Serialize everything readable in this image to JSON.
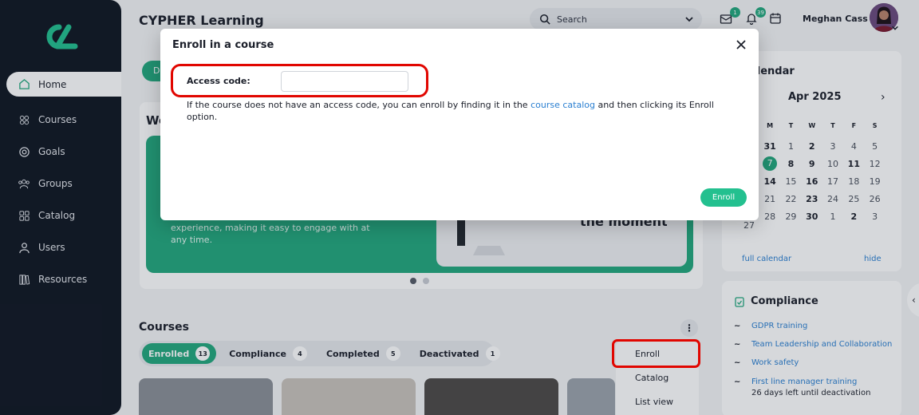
{
  "app": {
    "title": "CYPHER Learning"
  },
  "colors": {
    "accent": "#23a87d",
    "highlight": "#e10600",
    "link": "#2a7fd1",
    "sidebar": "#0f1622"
  },
  "sidebar": {
    "items": [
      {
        "label": "Home",
        "icon": "home-icon"
      },
      {
        "label": "Courses",
        "icon": "courses-icon"
      },
      {
        "label": "Goals",
        "icon": "goals-icon"
      },
      {
        "label": "Groups",
        "icon": "groups-icon"
      },
      {
        "label": "Catalog",
        "icon": "catalog-icon"
      },
      {
        "label": "Users",
        "icon": "users-icon"
      },
      {
        "label": "Resources",
        "icon": "resources-icon"
      }
    ]
  },
  "header": {
    "search_placeholder": "Search",
    "messages_badge": "1",
    "notifications_badge": "39",
    "user_name": "Meghan Cass"
  },
  "main": {
    "welcome_partial": "We",
    "pill_partial": "D",
    "panel_text": "experience, making it easy to engage with at any time.",
    "panel_heading_partial": "the moment",
    "courses_title": "Courses",
    "kebab": "⋮",
    "tabs": [
      {
        "label": "Enrolled",
        "count": "13"
      },
      {
        "label": "Compliance",
        "count": "4"
      },
      {
        "label": "Completed",
        "count": "5"
      },
      {
        "label": "Deactivated",
        "count": "1"
      }
    ],
    "menu": [
      "Enroll",
      "Catalog",
      "List view"
    ]
  },
  "calendar": {
    "title": "Calendar",
    "title_visible": "alendar",
    "month": "Apr 2025",
    "weekdays": [
      "M",
      "T",
      "W",
      "T",
      "F",
      "S"
    ],
    "weeks": [
      [
        "31",
        "1",
        "2",
        "3",
        "4",
        "5"
      ],
      [
        "7",
        "8",
        "9",
        "10",
        "11",
        "12"
      ],
      [
        "14",
        "15",
        "16",
        "17",
        "18",
        "19"
      ],
      [
        "21",
        "22",
        "23",
        "24",
        "25",
        "26"
      ],
      [
        "28",
        "29",
        "30",
        "1",
        "2",
        "3"
      ]
    ],
    "partial_col": [
      "27"
    ],
    "full_calendar": "full calendar",
    "hide": "hide"
  },
  "compliance": {
    "title": "Compliance",
    "items": [
      "GDPR training",
      "Team Leadership and Collaboration",
      "Work safety",
      "First line manager training"
    ],
    "last_item_sub": "26 days left until deactivation"
  },
  "modal": {
    "title": "Enroll in a course",
    "access_label": "Access code:",
    "access_value": "",
    "help_before": "If the course does not have an access code, you can enroll by finding it in the ",
    "help_link": "course catalog",
    "help_after": " and then clicking its Enroll option.",
    "enroll_label": "Enroll"
  }
}
